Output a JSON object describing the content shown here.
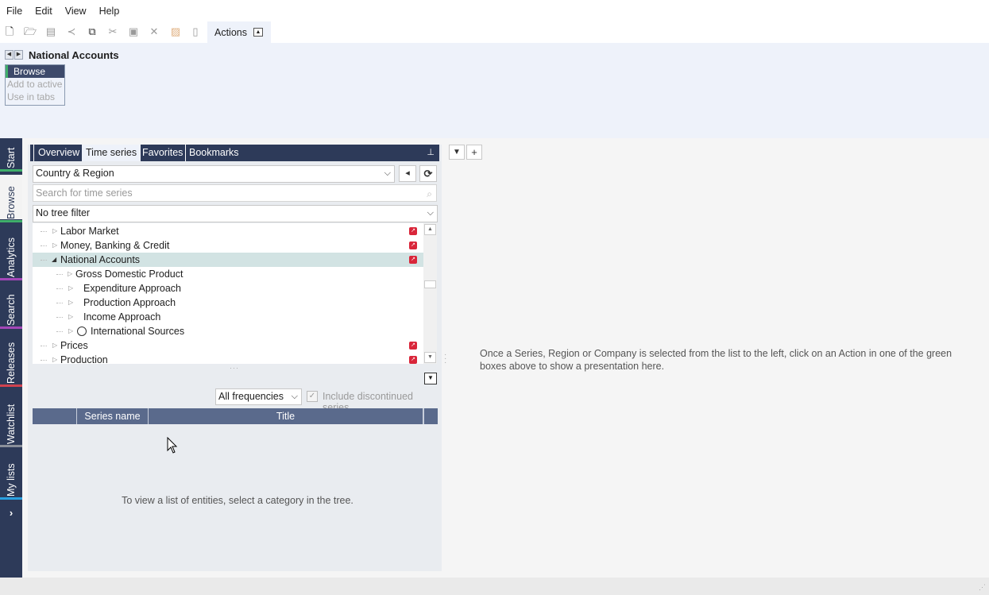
{
  "menu": {
    "file": "File",
    "edit": "Edit",
    "view": "View",
    "help": "Help"
  },
  "toolbar": {
    "icons": [
      "new-document-icon",
      "open-folder-icon",
      "save-icon",
      "share-icon",
      "copy-icon",
      "cut-icon",
      "paste-icon",
      "delete-icon",
      "highlight-icon",
      "clipboard-icon"
    ],
    "actions_label": "Actions",
    "collapse_glyph": "▲"
  },
  "breadcrumb": {
    "title": "National Accounts"
  },
  "browse_box": {
    "header": "Browse",
    "items": [
      "Add to active",
      "Use in tabs"
    ]
  },
  "side_tabs": [
    {
      "label": "Start",
      "stripe": "#3fae6a"
    },
    {
      "label": "Browse",
      "stripe": "#3fae6a"
    },
    {
      "label": "Analytics",
      "stripe": "#3fae6a"
    },
    {
      "label": "Search",
      "stripe": "#a347b8"
    },
    {
      "label": "Releases",
      "stripe": "#a347b8"
    },
    {
      "label": "Watchlist",
      "stripe": "#d0424f"
    },
    {
      "label": "My lists",
      "stripe": "#2aa0e0"
    }
  ],
  "side_more": "›",
  "panel": {
    "tabs": [
      "Overview",
      "Time series",
      "Favorites",
      "Bookmarks"
    ],
    "selected_tab": "Time series",
    "root_dropdown": "Country & Region",
    "search_placeholder": "Search for time series",
    "tree_filter": "No tree filter",
    "tree": [
      {
        "label": "Labor Market",
        "level": 0,
        "expanded": false,
        "selected": false,
        "badge": true
      },
      {
        "label": "Money, Banking & Credit",
        "level": 0,
        "expanded": false,
        "selected": false,
        "badge": true
      },
      {
        "label": "National Accounts",
        "level": 0,
        "expanded": true,
        "selected": true,
        "badge": true
      },
      {
        "label": "Gross Domestic Product",
        "level": 1,
        "expanded": false,
        "selected": false,
        "badge": false
      },
      {
        "label": "Expenditure Approach",
        "level": 2,
        "expanded": false,
        "selected": false,
        "badge": false
      },
      {
        "label": "Production Approach",
        "level": 2,
        "expanded": false,
        "selected": false,
        "badge": false
      },
      {
        "label": "Income Approach",
        "level": 2,
        "expanded": false,
        "selected": false,
        "badge": false
      },
      {
        "label": "International Sources",
        "level": 2,
        "expanded": false,
        "selected": false,
        "badge": false,
        "globe": true
      },
      {
        "label": "Prices",
        "level": 0,
        "expanded": false,
        "selected": false,
        "badge": true
      },
      {
        "label": "Production",
        "level": 0,
        "expanded": false,
        "selected": false,
        "badge": true
      }
    ],
    "frequency": "All frequencies",
    "include_discontinued_label": "Include discontinued series",
    "include_discontinued_checked": true,
    "columns": [
      "",
      "Series name",
      "Title"
    ],
    "empty_message": "To view a list of entities, select a category in the tree."
  },
  "right": {
    "hint": "Once a Series, Region or Company is selected from the list to the left, click on an Action in one of the green boxes above to show a presentation here."
  }
}
